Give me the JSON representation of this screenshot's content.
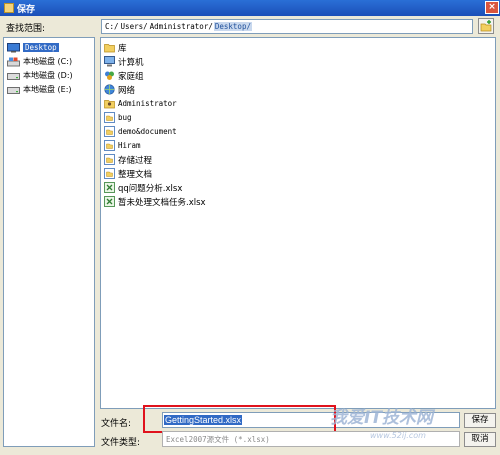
{
  "window": {
    "title": "保存"
  },
  "lookin": {
    "label": "查找范围:",
    "path": [
      "C:/",
      "Users/",
      "Administrator/",
      "Desktop/"
    ]
  },
  "sidebar": {
    "items": [
      {
        "label": "Desktop",
        "icon": "desktop-icon"
      },
      {
        "label": "本地磁盘 (C:)",
        "icon": "local-disk-c-icon"
      },
      {
        "label": "本地磁盘 (D:)",
        "icon": "drive-icon"
      },
      {
        "label": "本地磁盘 (E:)",
        "icon": "drive-icon"
      }
    ]
  },
  "files": [
    {
      "label": "库",
      "icon": "folder-icon"
    },
    {
      "label": "计算机",
      "icon": "computer-icon"
    },
    {
      "label": "家庭组",
      "icon": "homegroup-icon"
    },
    {
      "label": "网络",
      "icon": "network-icon"
    },
    {
      "label": "Administrator",
      "icon": "user-folder-icon"
    },
    {
      "label": "bug",
      "icon": "folder-shortcut-icon"
    },
    {
      "label": "demo&document",
      "icon": "folder-shortcut-icon"
    },
    {
      "label": "Hiram",
      "icon": "folder-shortcut-icon"
    },
    {
      "label": "存储过程",
      "icon": "folder-shortcut-icon"
    },
    {
      "label": "整理文档",
      "icon": "folder-shortcut-icon"
    },
    {
      "label": "qq问题分析.xlsx",
      "icon": "excel-file-icon"
    },
    {
      "label": "暂未处理文档任务.xlsx",
      "icon": "excel-file-icon"
    }
  ],
  "filename": {
    "label": "文件名:",
    "value": "GettingStarted.xlsx"
  },
  "filetype": {
    "label": "文件类型:",
    "value": "Excel2007源文件 (*.xlsx)"
  },
  "buttons": {
    "save": "保存",
    "cancel": "取消"
  },
  "watermark": {
    "text": "我爱IT技术网",
    "url": "www.52ij.com"
  }
}
